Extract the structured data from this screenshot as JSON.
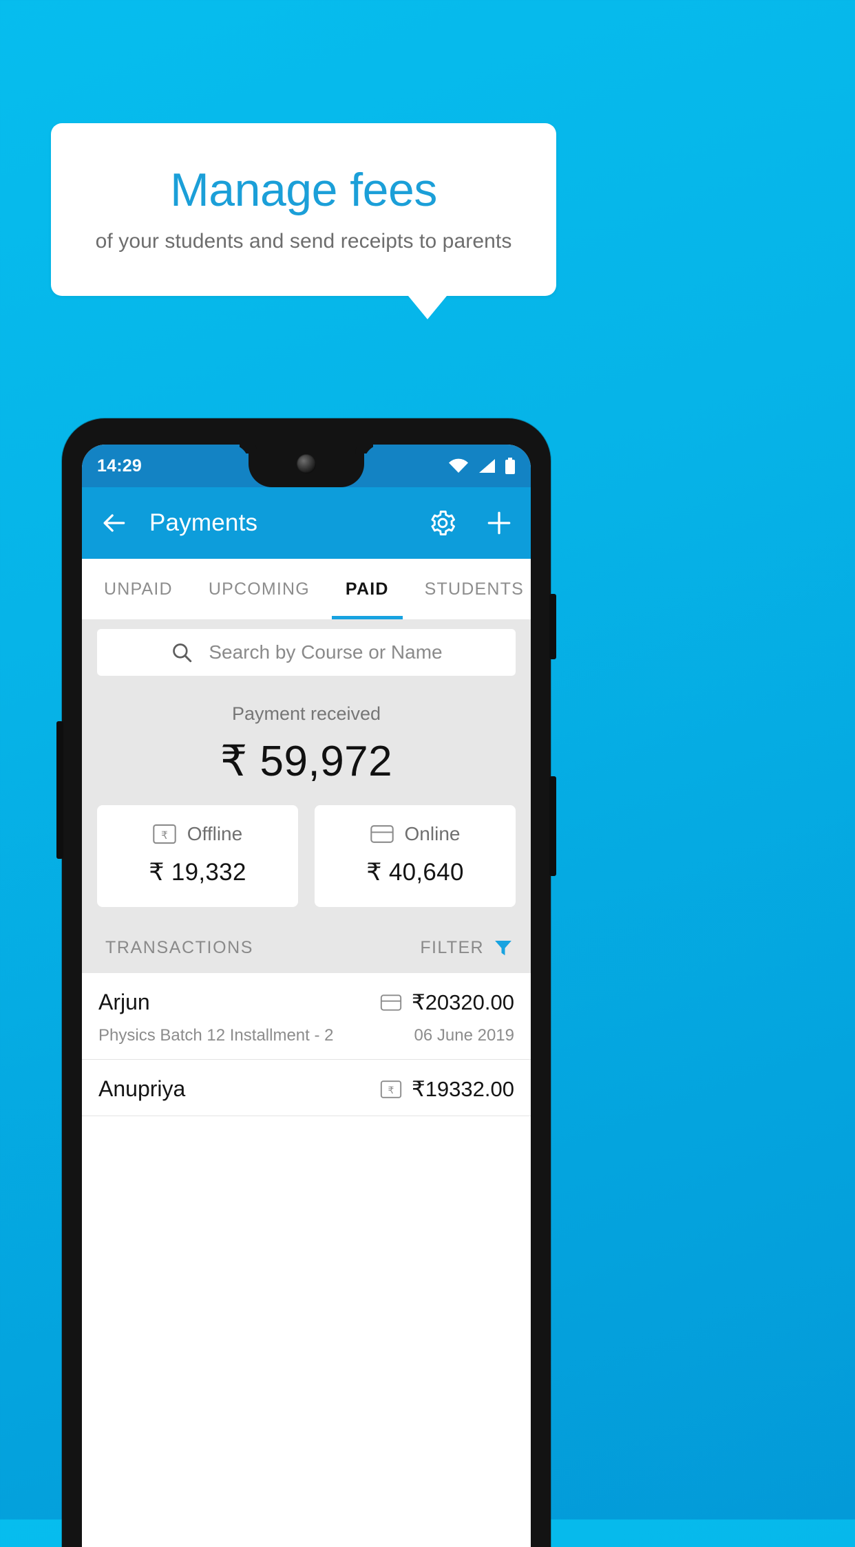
{
  "theme": {
    "background_blue": "#06b4e8",
    "brand_blue": "#1b9fd8",
    "appbar_blue": "#0d9ddb",
    "statusbar_blue": "#1383c4",
    "accent_blue": "#17a2e0",
    "surface_gray": "#e7e7e7"
  },
  "callout": {
    "title": "Manage fees",
    "subtitle": "of your students and send receipts to parents"
  },
  "phone": {
    "statusbar": {
      "clock": "14:29",
      "icons": [
        "wifi-icon",
        "signal-icon",
        "battery-icon"
      ]
    },
    "appbar": {
      "back_icon": "back-arrow-icon",
      "title": "Payments",
      "actions": [
        "gear-icon",
        "plus-icon"
      ]
    },
    "tabs": [
      {
        "label": "UNPAID",
        "active": false
      },
      {
        "label": "UPCOMING",
        "active": false
      },
      {
        "label": "PAID",
        "active": true
      },
      {
        "label": "STUDENTS",
        "active": false
      }
    ],
    "search": {
      "icon": "search-icon",
      "placeholder": "Search by Course or Name",
      "value": ""
    },
    "summary": {
      "label": "Payment received",
      "amount": "₹ 59,972"
    },
    "payment_cards": [
      {
        "icon": "rupee-note-icon",
        "label": "Offline",
        "amount": "₹ 19,332"
      },
      {
        "icon": "credit-card-icon",
        "label": "Online",
        "amount": "₹ 40,640"
      }
    ],
    "transactions_header": {
      "title": "TRANSACTIONS",
      "filter_label": "FILTER",
      "filter_icon": "funnel-icon"
    },
    "transactions": [
      {
        "name": "Arjun",
        "method_icon": "credit-card-icon",
        "amount": "₹20320.00",
        "description": "Physics Batch 12 Installment - 2",
        "date": "06 June 2019"
      },
      {
        "name": "Anupriya",
        "method_icon": "rupee-note-icon",
        "amount": "₹19332.00",
        "description": "",
        "date": ""
      }
    ]
  }
}
